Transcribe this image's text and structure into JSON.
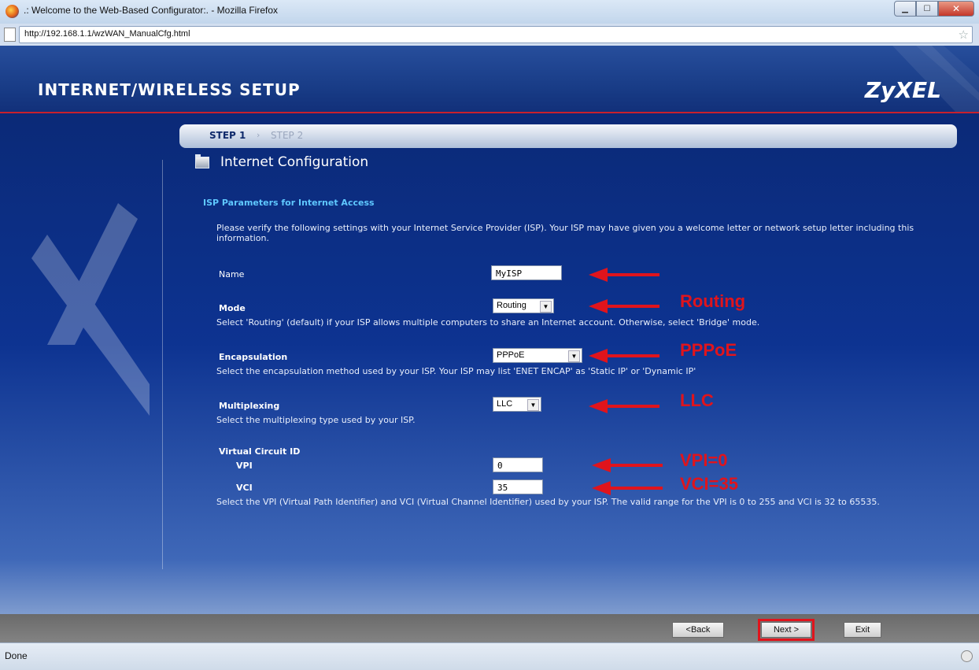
{
  "window": {
    "title": ".: Welcome to the Web-Based Configurator:. - Mozilla Firefox",
    "url": "http://192.168.1.1/wzWAN_ManualCfg.html",
    "status": "Done"
  },
  "header": {
    "title": "INTERNET/WIRELESS SETUP",
    "logo": "ZyXEL"
  },
  "steps": {
    "step1": "STEP 1",
    "arrow": "›",
    "step2": "STEP 2"
  },
  "section": {
    "title": "Internet Configuration",
    "heading": "ISP Parameters for Internet Access",
    "intro": "Please verify the following settings with your Internet Service Provider (ISP). Your ISP may have given you a welcome letter or network setup letter including this information."
  },
  "form": {
    "name": {
      "label": "Name",
      "value": "MyISP"
    },
    "mode": {
      "label": "Mode",
      "value": "Routing",
      "description": "Select 'Routing' (default) if your ISP allows multiple computers to share an Internet account. Otherwise, select 'Bridge' mode."
    },
    "encapsulation": {
      "label": "Encapsulation",
      "value": "PPPoE",
      "description": "Select the encapsulation method used by your ISP. Your ISP may list 'ENET ENCAP' as 'Static IP' or 'Dynamic IP'"
    },
    "multiplexing": {
      "label": "Multiplexing",
      "value": "LLC",
      "description": "Select the multiplexing type used by your ISP."
    },
    "vc": {
      "label": "Virtual Circuit ID",
      "vpi_label": "VPI",
      "vpi_value": "0",
      "vci_label": "VCI",
      "vci_value": "35",
      "description": "Select the VPI (Virtual Path Identifier) and VCI (Virtual Channel Identifier) used by your ISP. The valid range for the VPI is 0 to 255 and VCI is 32 to 65535."
    }
  },
  "annotations": {
    "mode": "Routing",
    "encapsulation": "PPPoE",
    "multiplexing": "LLC",
    "vpi": "VPI=0",
    "vci": "VCI=35",
    "color": "#e0141c"
  },
  "buttons": {
    "back": "<Back",
    "next": "Next >",
    "exit": "Exit"
  },
  "icons": {
    "browser": "firefox-icon",
    "page": "page-icon",
    "bookmark": "star-icon",
    "folder": "folder-icon",
    "dropdown": "chevron-down-icon"
  }
}
